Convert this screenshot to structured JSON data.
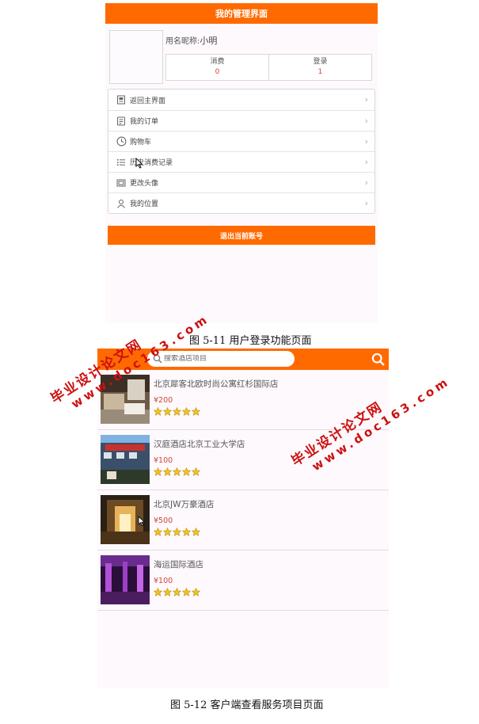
{
  "screen1": {
    "title": "我的管理界面",
    "nickname_label": "用名昵称:",
    "nickname_value": "小明",
    "stats": [
      {
        "label": "消费",
        "value": "0"
      },
      {
        "label": "登录",
        "value": "1"
      }
    ],
    "menu": [
      {
        "icon": "home-icon",
        "label": "返回主界面"
      },
      {
        "icon": "order-icon",
        "label": "我的订单"
      },
      {
        "icon": "clock-icon",
        "label": "购物车"
      },
      {
        "icon": "list-icon",
        "label": "历史消费记录"
      },
      {
        "icon": "image-icon",
        "label": "更改头像"
      },
      {
        "icon": "person-icon",
        "label": "我的位置"
      }
    ],
    "logout_label": "退出当前账号"
  },
  "caption1": "图 5-11 用户登录功能页面",
  "screen2": {
    "search_placeholder": "搜索酒店项目",
    "hotels": [
      {
        "name": "北京犀客北欧时尚公寓红杉国际店",
        "price": "¥200",
        "rating": 5
      },
      {
        "name": "汉庭酒店北京工业大学店",
        "price": "¥100",
        "rating": 5
      },
      {
        "name": "北京JW万豪酒店",
        "price": "¥500",
        "rating": 5
      },
      {
        "name": "海运国际酒店",
        "price": "¥100",
        "rating": 5
      }
    ]
  },
  "caption2": "图 5-12  客户端查看服务项目页面",
  "watermark": {
    "line1": "毕业设计论文网",
    "line2": "www.doc163.com",
    "color": "#cc1111"
  },
  "colors": {
    "accent": "#ff6a00",
    "price": "#d0453a",
    "star": "#f2c31d"
  }
}
